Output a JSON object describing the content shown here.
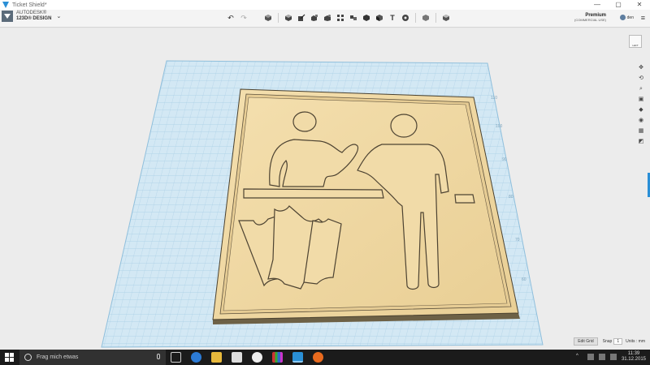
{
  "window": {
    "title": "Ticket Shield*",
    "controls": [
      "—",
      "▢",
      "✕"
    ]
  },
  "brand": {
    "line1": "AUTODESK®",
    "line2": "123D® DESIGN",
    "caret": "⌄"
  },
  "toolbar": {
    "undo_icon": "undo-icon",
    "redo_icon": "redo-icon",
    "undo_glyph": "↶",
    "redo_glyph": "↷",
    "tool_icons": [
      "primitives-icon",
      "sketch-icon",
      "construct-icon",
      "modify-icon",
      "pattern-icon",
      "group-icon",
      "combine-icon",
      "measure-icon",
      "text-icon",
      "snap-icon",
      "material-icon",
      "layers-icon"
    ],
    "text_glyph": "T"
  },
  "account": {
    "plan": "Premium",
    "plan_note": "(COMMERCIAL USE)",
    "user": "den"
  },
  "viewcube": {
    "label": "LEFT"
  },
  "nav_icons": [
    "pan-icon",
    "orbit-icon",
    "zoom-icon",
    "fit-icon",
    "view-icon",
    "visibility-icon",
    "grid-icon",
    "material-view-icon"
  ],
  "nav_glyphs": [
    "✥",
    "⟲",
    "⌕",
    "▣",
    "◆",
    "◉",
    "▦",
    "◩"
  ],
  "bottom": {
    "edit_grid": "Edit Grid",
    "snap_label": "Snap",
    "snap_value": "1",
    "units": "Units : mm"
  },
  "taskbar": {
    "search_placeholder": "Frag mich etwas",
    "time": "11:39",
    "date": "31.12.2015"
  },
  "colors": {
    "grid_plane": "#cfe6f3",
    "grid_line": "#9fc9e2",
    "part_face": "#f3dcaa",
    "part_edge": "#5d513c",
    "accent": "#2a8fd6"
  }
}
